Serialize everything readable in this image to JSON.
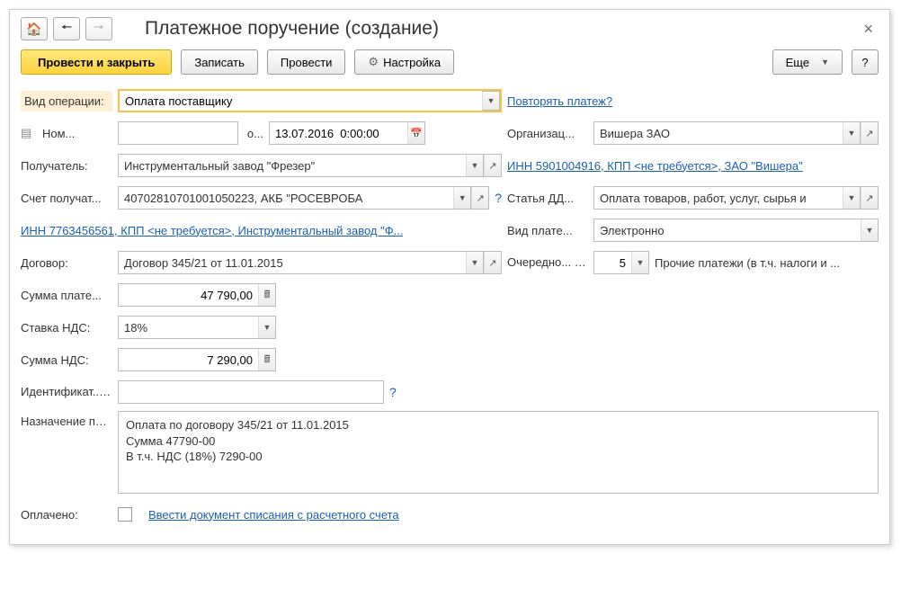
{
  "title": "Платежное поручение (создание)",
  "toolbar": {
    "post_close": "Провести и закрыть",
    "save": "Записать",
    "post": "Провести",
    "settings": "Настройка",
    "more": "Еще",
    "help": "?"
  },
  "left": {
    "operation_label": "Вид операции:",
    "operation_value": "Оплата поставщику",
    "number_label": "Ном...",
    "number_value": "",
    "from_label": "о...",
    "date_value": "13.07.2016  0:00:00",
    "recipient_label": "Получатель:",
    "recipient_value": "Инструментальный завод \"Фрезер\"",
    "acct_label": "Счет получат...",
    "acct_value": "40702810701001050223, АКБ \"РОСЕВРОБА",
    "inn_link": "ИНН 7763456561, КПП <не требуется>, Инструментальный завод \"Ф...",
    "contract_label": "Договор:",
    "contract_value": "Договор 345/21 от 11.01.2015",
    "sum_label": "Сумма плате...",
    "sum_value": "47 790,00",
    "vat_rate_label": "Ставка НДС:",
    "vat_rate_value": "18%",
    "vat_sum_label": "Сумма НДС:",
    "vat_sum_value": "7 290,00",
    "ident_label": "Идентификат... платежа:",
    "ident_value": "",
    "purpose_label": "Назначение платежа:",
    "purpose_value": "Оплата по договору 345/21 от 11.01.2015\nСумма 47790-00\nВ т.ч. НДС  (18%) 7290-00",
    "paid_label": "Оплачено:",
    "paid_link": "Ввести документ списания с расчетного счета"
  },
  "right": {
    "repeat_link": "Повторять платеж?",
    "org_label": "Организац...",
    "org_value": "Вишера ЗАО",
    "inn_link": "ИНН 5901004916, КПП <не требуется>, ЗАО \"Вишера\"",
    "dds_label": "Статья ДД...",
    "dds_value": "Оплата товаров, работ, услуг, сырья и",
    "pay_type_label": "Вид плате...",
    "pay_type_value": "Электронно",
    "priority_label": "Очередно... платежа:",
    "priority_value": "5",
    "priority_note": "Прочие платежи (в т.ч. налоги и ..."
  }
}
